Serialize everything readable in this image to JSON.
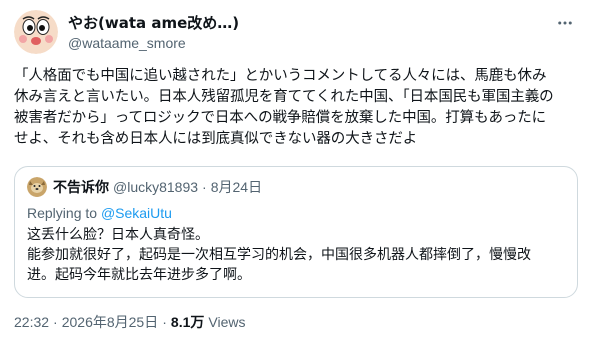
{
  "author": {
    "display_name": "やお(wata ame改め…)",
    "handle": "@wataame_smore",
    "avatar_icon": "cartoon-face-avatar"
  },
  "tweet": {
    "lines": [
      "「人格面でも中国に追い越された」とかいうコメントしてる人々には、馬鹿も休み",
      "休み言えと言いたい。日本人残留孤児を育ててくれた中国、「日本国民も軍国主義の",
      "被害者だから」ってロジックで日本への戦争賠償を放棄した中国。打算もあったに",
      "せよ、それも含め日本人には到底真似できない器の大きさだよ"
    ]
  },
  "quote": {
    "display_name": "不告诉你",
    "handle": "@lucky81893",
    "separator": "·",
    "date": "8月24日",
    "replying_label": "Replying to",
    "replying_to": "@SekaiUtu",
    "lines": [
      "这丢什么脸？日本人真奇怪。",
      "能参加就很好了，起码是一次相互学习的机会，中国很多机器人都摔倒了，慢慢改",
      "进。起码今年就比去年进步多了啊。"
    ]
  },
  "footer": {
    "time": "22:32",
    "date": "2026年8月25日",
    "separator": "·",
    "views_count": "8.1万",
    "views_label": "Views"
  },
  "colors": {
    "text": "#0f1419",
    "secondary": "#536471",
    "link": "#1d9bf0",
    "border": "#cfd9de"
  }
}
